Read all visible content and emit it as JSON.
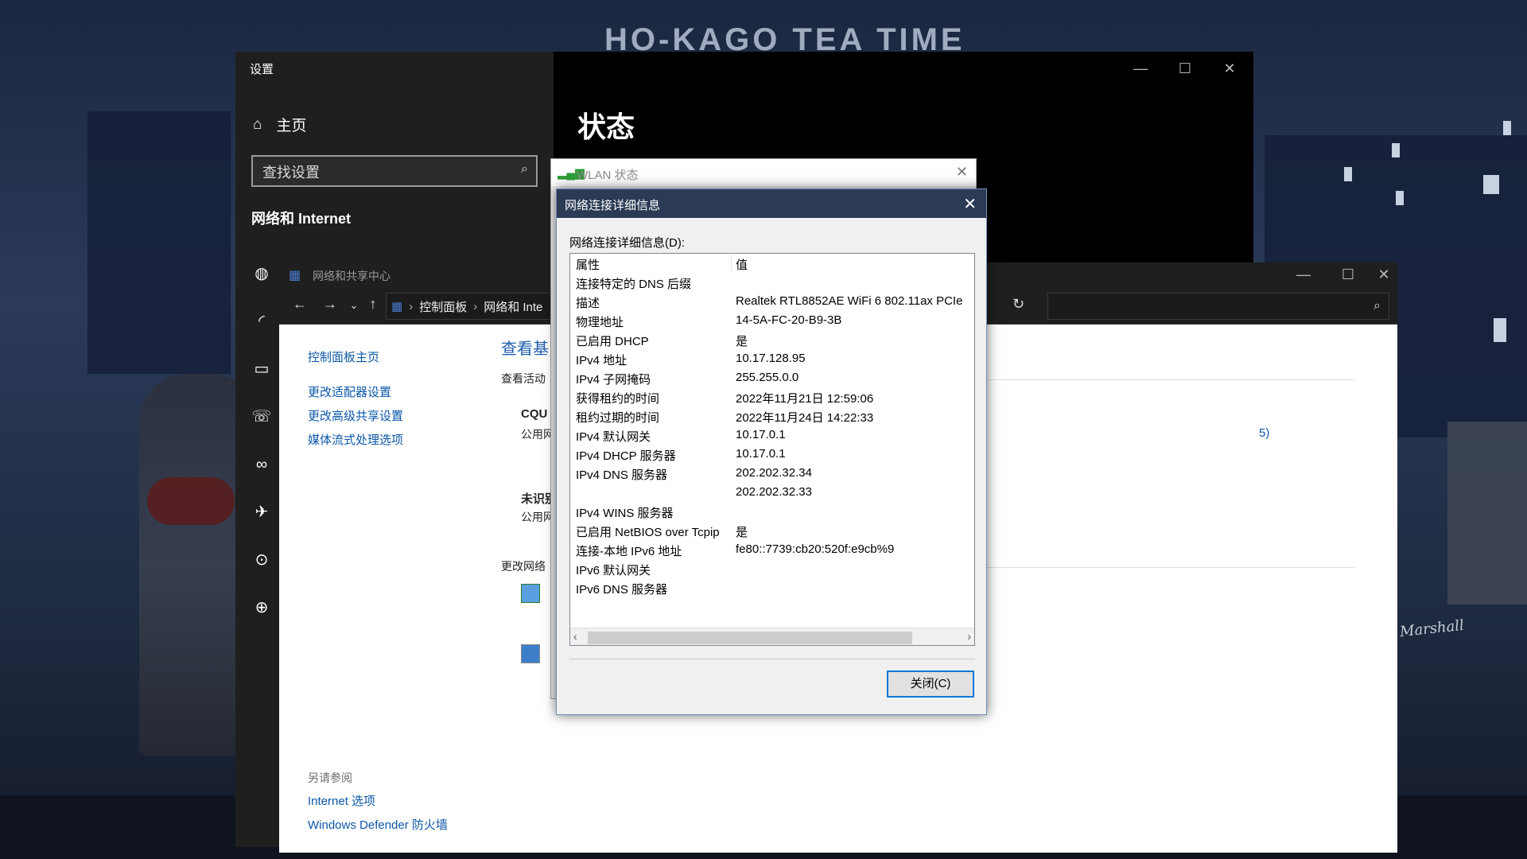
{
  "wallpaper": {
    "title": "HO-KAGO TEA TIME",
    "amp_brand": "Marshall"
  },
  "settings": {
    "window_title": "设置",
    "home": "主页",
    "search_placeholder": "查找设置",
    "section": "网络和 Internet",
    "page_title": "状态",
    "nav_icons": [
      "globe-status-icon",
      "wifi-icon",
      "ethernet-icon",
      "dialup-icon",
      "vpn-icon",
      "airplane-icon",
      "hotspot-icon",
      "proxy-icon"
    ]
  },
  "nsc": {
    "window_title": "网络和共享中心",
    "breadcrumb": [
      "控制面板",
      "网络和 Inte"
    ],
    "left_links": [
      "控制面板主页",
      "更改适配器设置",
      "更改高级共享设置",
      "媒体流式处理选项"
    ],
    "heading": "查看基",
    "active_label": "查看活动",
    "network1_name": "CQU",
    "network1_type": "公用网",
    "network2_name": "未识别",
    "network2_type": "公用网",
    "change_label": "更改网络",
    "right_fragment": "5)",
    "see_also": "另请参阅",
    "see_also_links": [
      "Internet 选项",
      "Windows Defender 防火墙"
    ]
  },
  "wlan": {
    "title": "WLAN 状态"
  },
  "details": {
    "title": "网络连接详细信息",
    "list_label": "网络连接详细信息(D):",
    "columns": {
      "key": "属性",
      "value": "值"
    },
    "rows": [
      {
        "k": "连接特定的 DNS 后缀",
        "v": ""
      },
      {
        "k": "描述",
        "v": "Realtek RTL8852AE WiFi 6 802.11ax PCIe"
      },
      {
        "k": "物理地址",
        "v": "14-5A-FC-20-B9-3B"
      },
      {
        "k": "已启用 DHCP",
        "v": "是"
      },
      {
        "k": "IPv4 地址",
        "v": "10.17.128.95"
      },
      {
        "k": "IPv4 子网掩码",
        "v": "255.255.0.0"
      },
      {
        "k": "获得租约的时间",
        "v": "2022年11月21日 12:59:06"
      },
      {
        "k": "租约过期的时间",
        "v": "2022年11月24日 14:22:33"
      },
      {
        "k": "IPv4 默认网关",
        "v": "10.17.0.1"
      },
      {
        "k": "IPv4 DHCP 服务器",
        "v": "10.17.0.1"
      },
      {
        "k": "IPv4 DNS 服务器",
        "v": "202.202.32.34"
      },
      {
        "k": "",
        "v": "202.202.32.33"
      },
      {
        "k": "IPv4 WINS 服务器",
        "v": ""
      },
      {
        "k": "已启用 NetBIOS over Tcpip",
        "v": "是"
      },
      {
        "k": "连接-本地 IPv6 地址",
        "v": "fe80::7739:cb20:520f:e9cb%9"
      },
      {
        "k": "IPv6 默认网关",
        "v": ""
      },
      {
        "k": "IPv6 DNS 服务器",
        "v": ""
      }
    ],
    "close_button": "关闭(C)"
  }
}
